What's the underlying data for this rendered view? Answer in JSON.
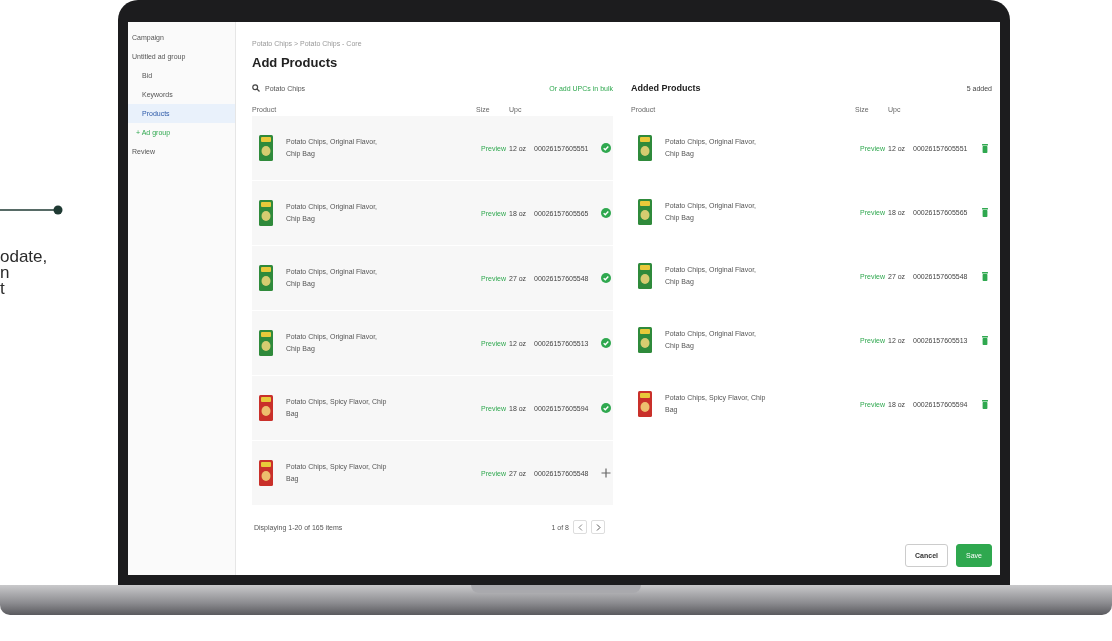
{
  "caption": {
    "lines": [
      "odate,",
      "n",
      "t"
    ]
  },
  "sidebar": {
    "items": [
      {
        "label": "Campaign",
        "selected": false
      },
      {
        "label": "Untitled ad group",
        "selected": false,
        "children": [
          {
            "label": "Bid",
            "selected": false
          },
          {
            "label": "Keywords",
            "selected": false
          },
          {
            "label": "Products",
            "selected": true
          }
        ]
      },
      {
        "label": "+ Ad group",
        "selected": false,
        "kind": "link"
      },
      {
        "label": "Review",
        "selected": false
      }
    ]
  },
  "breadcrumb": "Potato Chips > Potato Chips - Core",
  "title": "Add Products",
  "search": {
    "value": "Potato Chips"
  },
  "bulk_link": "Or add UPCs in bulk",
  "results": {
    "columns": [
      "Product",
      "Size",
      "Upc"
    ],
    "rows": [
      {
        "name": "Potato Chips, Original Flavor, Chip Bag",
        "color": "#2f8a3b",
        "preview": "Preview",
        "size": "12 oz",
        "upc": "00026157605551",
        "added": true
      },
      {
        "name": "Potato Chips, Original Flavor, Chip Bag",
        "color": "#2f8a3b",
        "preview": "Preview",
        "size": "18 oz",
        "upc": "00026157605565",
        "added": true
      },
      {
        "name": "Potato Chips, Original Flavor, Chip Bag",
        "color": "#2f8a3b",
        "preview": "Preview",
        "size": "27 oz",
        "upc": "00026157605548",
        "added": true
      },
      {
        "name": "Potato Chips, Original Flavor, Chip Bag",
        "color": "#2f8a3b",
        "preview": "Preview",
        "size": "12 oz",
        "upc": "00026157605513",
        "added": true
      },
      {
        "name": "Potato Chips, Spicy Flavor, Chip Bag",
        "color": "#c9302a",
        "preview": "Preview",
        "size": "18 oz",
        "upc": "00026157605594",
        "added": true
      },
      {
        "name": "Potato Chips, Spicy Flavor, Chip Bag",
        "color": "#c9302a",
        "preview": "Preview",
        "size": "27 oz",
        "upc": "00026157605548",
        "added": false
      }
    ],
    "footer": "Displaying 1-20 of 165 items",
    "pagination": "1 of 8"
  },
  "added": {
    "title": "Added Products",
    "count": "5 added",
    "columns": [
      "Product",
      "Size",
      "Upc"
    ],
    "rows": [
      {
        "name": "Potato Chips, Original Flavor, Chip Bag",
        "color": "#2f8a3b",
        "preview": "Preview",
        "size": "12 oz",
        "upc": "00026157605551"
      },
      {
        "name": "Potato Chips, Original Flavor, Chip Bag",
        "color": "#2f8a3b",
        "preview": "Preview",
        "size": "18 oz",
        "upc": "00026157605565"
      },
      {
        "name": "Potato Chips, Original Flavor, Chip Bag",
        "color": "#2f8a3b",
        "preview": "Preview",
        "size": "27 oz",
        "upc": "00026157605548"
      },
      {
        "name": "Potato Chips, Original Flavor, Chip Bag",
        "color": "#2f8a3b",
        "preview": "Preview",
        "size": "12 oz",
        "upc": "00026157605513"
      },
      {
        "name": "Potato Chips, Spicy Flavor, Chip Bag",
        "color": "#c9302a",
        "preview": "Preview",
        "size": "18 oz",
        "upc": "00026157605594"
      }
    ]
  },
  "buttons": [
    {
      "label": "Cancel",
      "kind": "secondary"
    },
    {
      "label": "Save",
      "kind": "primary"
    }
  ]
}
